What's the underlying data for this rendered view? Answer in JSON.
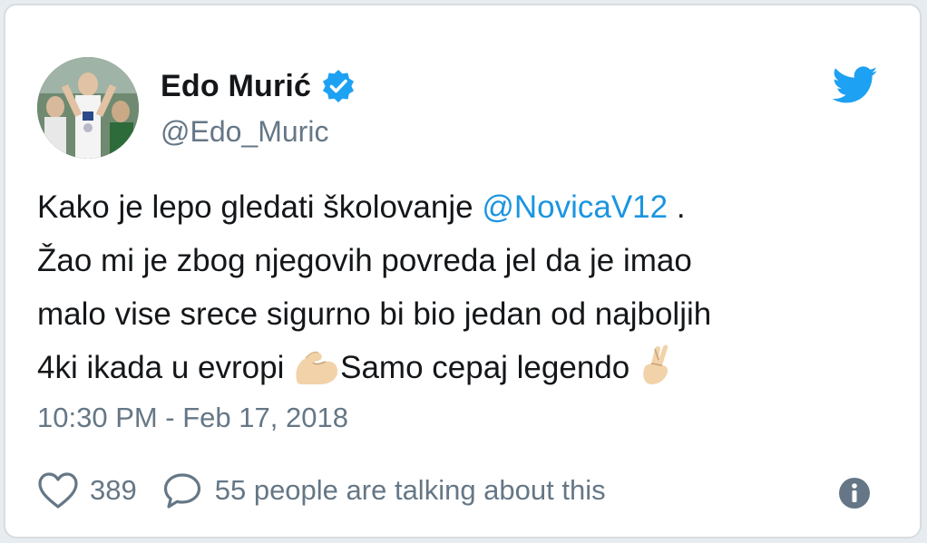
{
  "tweet": {
    "author_name": "Edo Murić",
    "handle": "@Edo_Muric",
    "text": {
      "line1_before": "Kako je lepo gledati školovanje ",
      "line1_mention": "@NovicaV12",
      "line1_after": " .",
      "line2": "Žao mi je zbog njegovih povreda jel da je imao",
      "line3": "malo vise srece sigurno bi bio jedan od najboljih",
      "line4_before": "4ki ikada u evropi ",
      "line4_middle": "Samo cepaj legendo "
    },
    "timestamp": "10:30 PM - Feb 17, 2018",
    "likes": "389",
    "talking": "55 people are talking about this"
  },
  "icons": {
    "verified": "verified-badge-icon",
    "bird": "twitter-bird-icon",
    "heart": "heart-icon",
    "reply": "speech-bubble-icon",
    "info": "info-icon",
    "emoji1": "flexed-biceps-emoji",
    "emoji2": "crossed-fingers-emoji"
  },
  "colors": {
    "accent": "#1da1f2",
    "mention": "#1b95e0",
    "muted": "#657786",
    "text": "#14171a"
  }
}
